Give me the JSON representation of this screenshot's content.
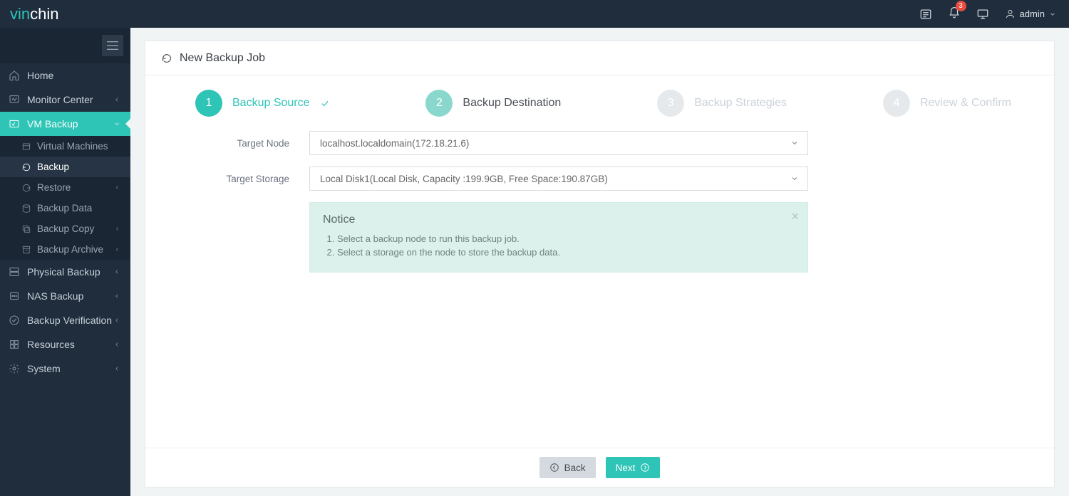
{
  "brand": {
    "part1": "vin",
    "part2": "chin"
  },
  "topbar": {
    "notifications_count": "3",
    "username": "admin"
  },
  "sidebar": {
    "items": [
      {
        "label": "Home"
      },
      {
        "label": "Monitor Center"
      },
      {
        "label": "VM Backup"
      },
      {
        "label": "Physical Backup"
      },
      {
        "label": "NAS Backup"
      },
      {
        "label": "Backup Verification"
      },
      {
        "label": "Resources"
      },
      {
        "label": "System"
      }
    ],
    "vm_backup_sub": [
      {
        "label": "Virtual Machines"
      },
      {
        "label": "Backup"
      },
      {
        "label": "Restore"
      },
      {
        "label": "Backup Data"
      },
      {
        "label": "Backup Copy"
      },
      {
        "label": "Backup Archive"
      }
    ]
  },
  "page": {
    "title": "New Backup Job",
    "steps": [
      {
        "num": "1",
        "label": "Backup Source"
      },
      {
        "num": "2",
        "label": "Backup Destination"
      },
      {
        "num": "3",
        "label": "Backup Strategies"
      },
      {
        "num": "4",
        "label": "Review & Confirm"
      }
    ],
    "form": {
      "target_node_label": "Target Node",
      "target_node_value": "localhost.localdomain(172.18.21.6)",
      "target_storage_label": "Target Storage",
      "target_storage_value": "Local Disk1(Local Disk, Capacity :199.9GB, Free Space:190.87GB)"
    },
    "notice": {
      "title": "Notice",
      "items": [
        "Select a backup node to run this backup job.",
        "Select a storage on the node to store the backup data."
      ]
    },
    "buttons": {
      "back": "Back",
      "next": "Next"
    }
  }
}
